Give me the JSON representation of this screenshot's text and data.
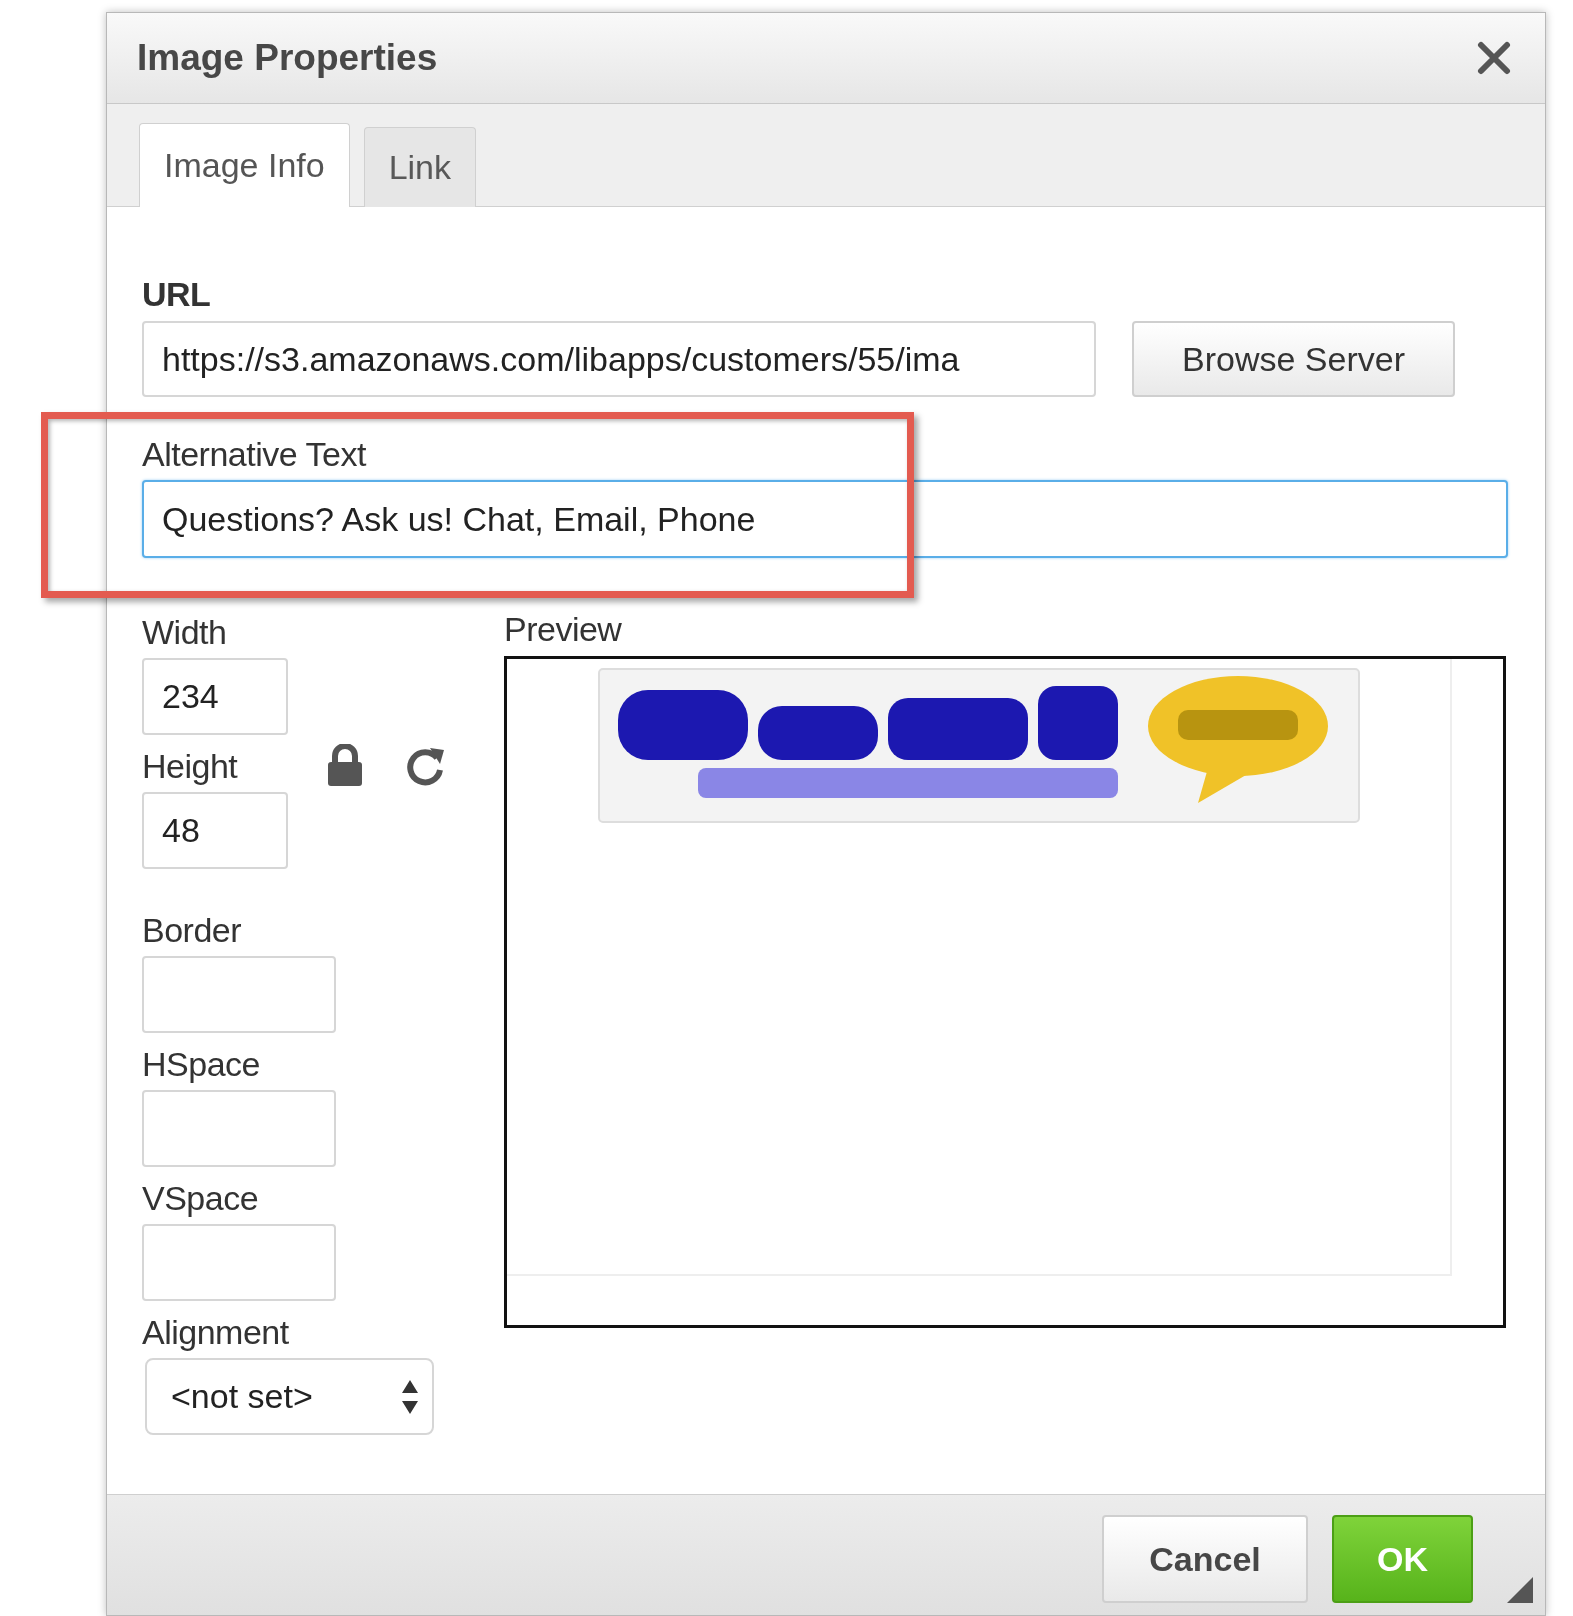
{
  "dialog": {
    "title": "Image Properties"
  },
  "tabs": [
    {
      "label": "Image Info",
      "selected": true
    },
    {
      "label": "Link",
      "selected": false
    }
  ],
  "url": {
    "label": "URL",
    "value": "https://s3.amazonaws.com/libapps/customers/55/ima",
    "button": "Browse Server"
  },
  "alt_text": {
    "label": "Alternative Text",
    "value": "Questions? Ask us! Chat, Email, Phone",
    "focused": true
  },
  "size_fields": [
    {
      "label": "Width",
      "value": "234"
    },
    {
      "label": "Height",
      "value": "48"
    }
  ],
  "spacing_fields": [
    {
      "label": "Border"
    },
    {
      "label": "HSpace"
    },
    {
      "label": "VSpace"
    }
  ],
  "alignment": {
    "label": "Alignment",
    "value": "<not set>"
  },
  "preview": {
    "label": "Preview"
  },
  "buttons": [
    {
      "label": "Cancel",
      "kind": "secondary"
    },
    {
      "label": "OK",
      "kind": "primary"
    }
  ]
}
